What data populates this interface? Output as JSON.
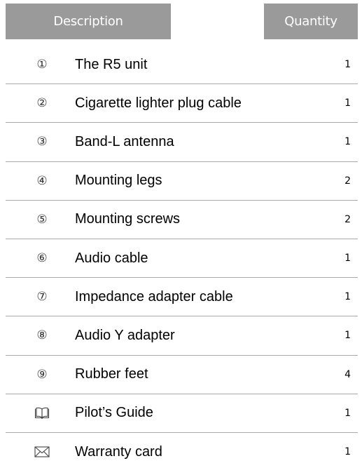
{
  "header": {
    "description": "Description",
    "quantity": "Quantity"
  },
  "rows": [
    {
      "marker": "①",
      "description": "The R5 unit",
      "quantity": "1"
    },
    {
      "marker": "②",
      "description": "Cigarette lighter plug cable",
      "quantity": "1"
    },
    {
      "marker": "③",
      "description": "Band-L antenna",
      "quantity": "1"
    },
    {
      "marker": "④",
      "description": "Mounting legs",
      "quantity": "2"
    },
    {
      "marker": "⑤",
      "description": "Mounting screws",
      "quantity": "2"
    },
    {
      "marker": "⑥",
      "description": "Audio cable",
      "quantity": "1"
    },
    {
      "marker": "⑦",
      "description": "Impedance adapter cable",
      "quantity": "1"
    },
    {
      "marker": "⑧",
      "description": "Audio Y adapter",
      "quantity": "1"
    },
    {
      "marker": "⑨",
      "description": "Rubber feet",
      "quantity": "4"
    },
    {
      "marker_icon": "book-icon",
      "description": "Pilot’s Guide",
      "quantity": "1"
    },
    {
      "marker_icon": "envelope-icon",
      "description": "Warranty card",
      "quantity": "1"
    }
  ],
  "colors": {
    "header_bg": "#9a9a9a",
    "header_text": "#ffffff",
    "divider": "#aaaaaa"
  }
}
